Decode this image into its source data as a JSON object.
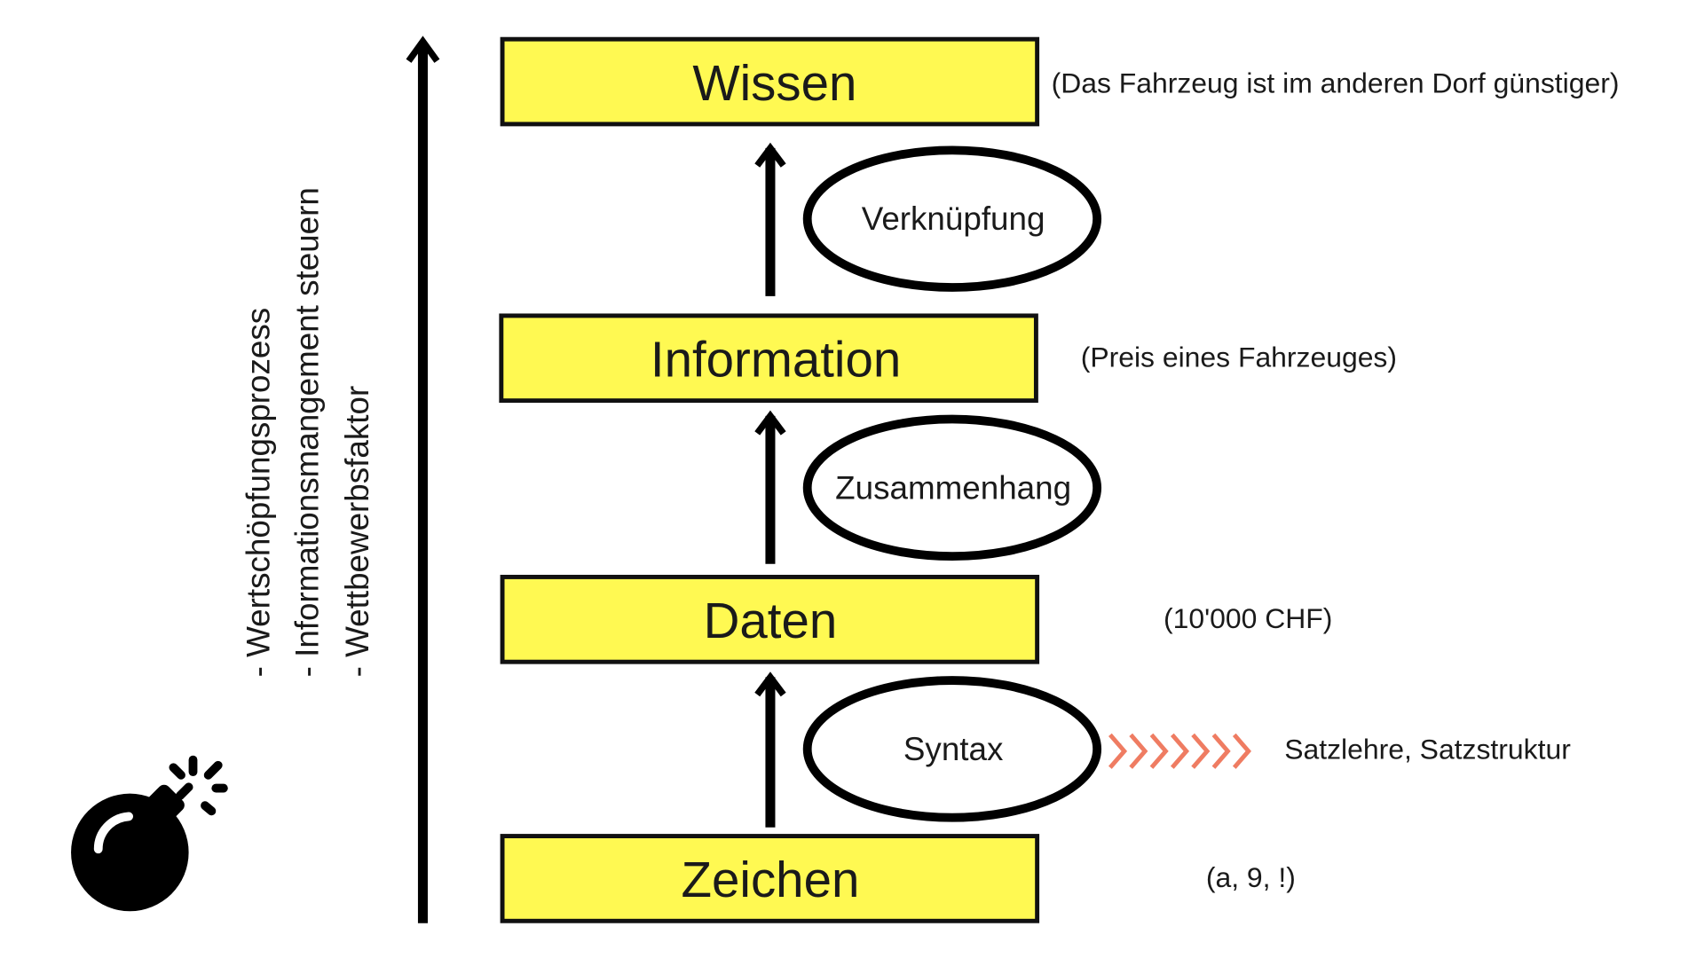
{
  "levels": [
    {
      "label": "Wissen",
      "example": "(Das Fahrzeug ist im anderen Dorf günstiger)"
    },
    {
      "label": "Information",
      "example": "(Preis eines Fahrzeuges)"
    },
    {
      "label": "Daten",
      "example": "(10'000 CHF)"
    },
    {
      "label": "Zeichen",
      "example": "(a, 9, !)"
    }
  ],
  "processes": [
    {
      "label": "Verknüpfung"
    },
    {
      "label": "Zusammenhang"
    },
    {
      "label": "Syntax",
      "note": "Satzlehre, Satzstruktur"
    }
  ],
  "side_notes": [
    "- Wertschöpfungsprozess",
    "- Informationsmangement steuern",
    "- Wettbewerbsfaktor"
  ],
  "colors": {
    "box_fill": "#fff952",
    "chevron": "#ef7c62"
  },
  "icons": {
    "bomb": "bomb-icon"
  }
}
